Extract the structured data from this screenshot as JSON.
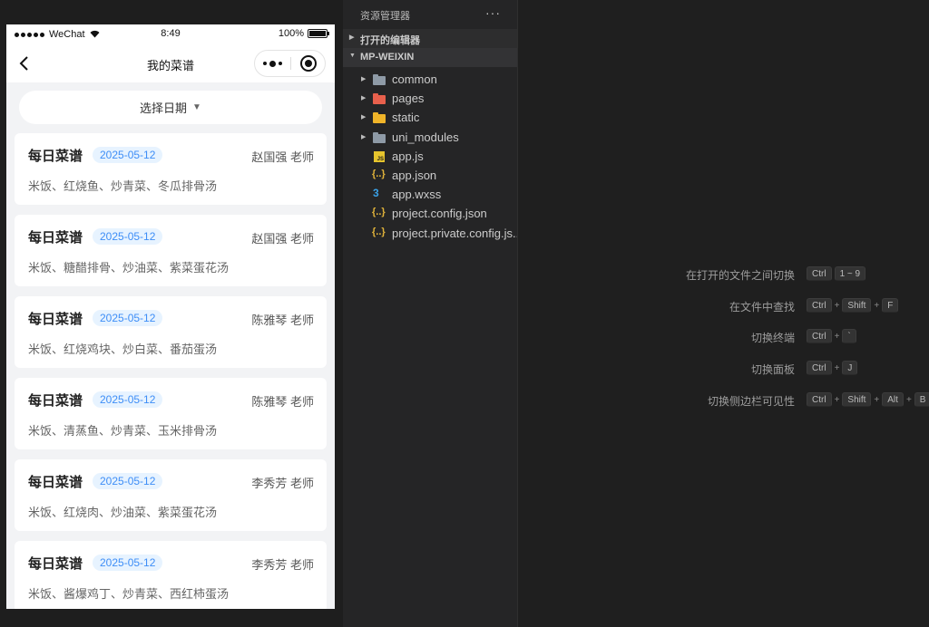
{
  "phone": {
    "status_bar": {
      "carrier": "WeChat",
      "time": "8:49",
      "battery_percent": "100%",
      "battery_level": 1.0,
      "signal_icon": "signal-dots-icon",
      "wifi_icon": "wifi-icon"
    },
    "nav": {
      "title": "我的菜谱",
      "back_icon": "chevron-left-icon",
      "menu_icon": "more-dots-icon",
      "close_icon": "record-circle-icon"
    },
    "date_picker": {
      "label": "选择日期",
      "caret": "▼"
    },
    "cards": [
      {
        "title": "每日菜谱",
        "date": "2025-05-12",
        "teacher": "赵国强 老师",
        "menu": "米饭、红烧鱼、炒青菜、冬瓜排骨汤"
      },
      {
        "title": "每日菜谱",
        "date": "2025-05-12",
        "teacher": "赵国强 老师",
        "menu": "米饭、糖醋排骨、炒油菜、紫菜蛋花汤"
      },
      {
        "title": "每日菜谱",
        "date": "2025-05-12",
        "teacher": "陈雅琴 老师",
        "menu": "米饭、红烧鸡块、炒白菜、番茄蛋汤"
      },
      {
        "title": "每日菜谱",
        "date": "2025-05-12",
        "teacher": "陈雅琴 老师",
        "menu": "米饭、清蒸鱼、炒青菜、玉米排骨汤"
      },
      {
        "title": "每日菜谱",
        "date": "2025-05-12",
        "teacher": "李秀芳 老师",
        "menu": "米饭、红烧肉、炒油菜、紫菜蛋花汤"
      },
      {
        "title": "每日菜谱",
        "date": "2025-05-12",
        "teacher": "李秀芳 老师",
        "menu": "米饭、酱爆鸡丁、炒青菜、西红柿蛋汤"
      }
    ]
  },
  "explorer": {
    "title": "资源管理器",
    "more": "···",
    "open_editors": "打开的编辑器",
    "project": "MP-WEIXIN",
    "items": [
      {
        "label": "common",
        "icon": "folder-icon",
        "expandable": true
      },
      {
        "label": "pages",
        "icon": "pages-folder-icon",
        "expandable": true
      },
      {
        "label": "static",
        "icon": "static-folder-icon",
        "expandable": true
      },
      {
        "label": "uni_modules",
        "icon": "folder-icon",
        "expandable": true
      },
      {
        "label": "app.js",
        "icon": "js-file-icon",
        "expandable": false
      },
      {
        "label": "app.json",
        "icon": "json-file-icon",
        "expandable": false
      },
      {
        "label": "app.wxss",
        "icon": "css-file-icon",
        "expandable": false
      },
      {
        "label": "project.config.json",
        "icon": "json-file-icon",
        "expandable": false
      },
      {
        "label": "project.private.config.js...",
        "icon": "json-file-icon",
        "expandable": false
      }
    ]
  },
  "editor_hints": [
    {
      "label": "在打开的文件之间切换",
      "keys": [
        "Ctrl",
        "1 ~ 9"
      ]
    },
    {
      "label": "在文件中查找",
      "keys": [
        "Ctrl",
        "+",
        "Shift",
        "+",
        "F"
      ]
    },
    {
      "label": "切换终端",
      "keys": [
        "Ctrl",
        "+",
        "`"
      ]
    },
    {
      "label": "切换面板",
      "keys": [
        "Ctrl",
        "+",
        "J"
      ]
    },
    {
      "label": "切换侧边栏可见性",
      "keys": [
        "Ctrl",
        "+",
        "Shift",
        "+",
        "Alt",
        "+",
        "B"
      ]
    }
  ],
  "colors": {
    "date_badge_bg": "#e7f3ff",
    "date_badge_text": "#3e8ef7",
    "explorer_bg": "#252526",
    "editor_bg": "#1f1f1f",
    "folder_gray": "#8e9aa6",
    "pages_folder": "#e8604c",
    "static_folder": "#f0b429"
  }
}
